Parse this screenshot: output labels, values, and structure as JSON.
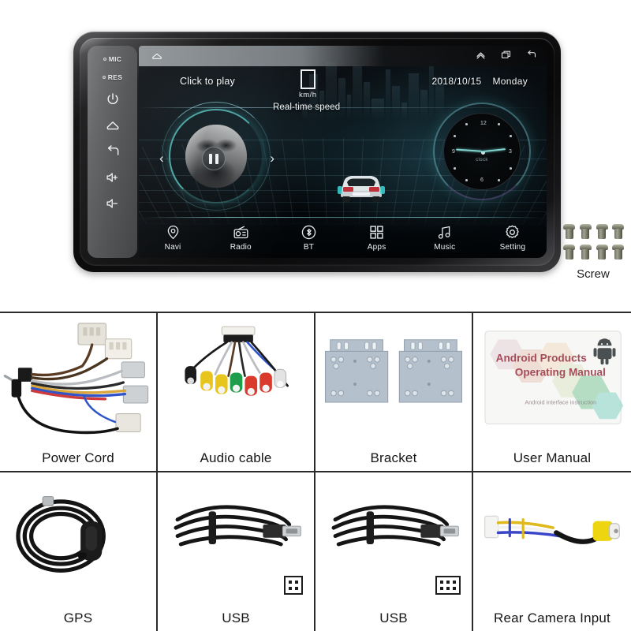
{
  "product": {
    "type": "car-stereo-head-unit-accessory-layout",
    "accent_color": "#5ad2cd",
    "frame_color": "#2b2b2b"
  },
  "head_unit": {
    "side_keys": [
      {
        "name": "mic-indicator",
        "label": "MIC",
        "icon": "led-dot"
      },
      {
        "name": "reset-indicator",
        "label": "RES",
        "icon": "led-dot"
      },
      {
        "name": "power-key",
        "label": "",
        "icon": "power-icon"
      },
      {
        "name": "home-key",
        "label": "",
        "icon": "home-icon"
      },
      {
        "name": "back-key",
        "label": "",
        "icon": "back-arrow-icon"
      },
      {
        "name": "volume-up-key",
        "label": "",
        "icon": "volume-up-icon"
      },
      {
        "name": "volume-down-key",
        "label": "",
        "icon": "volume-down-icon"
      }
    ],
    "status_bar": {
      "home_icon": "home-icon",
      "right_icons": [
        "chevron-up-icon",
        "recent-apps-icon",
        "back-arrow-icon"
      ]
    },
    "screen": {
      "media_hint": "Click to play",
      "speed_value": "",
      "speed_unit": "km/h",
      "speed_caption": "Real-time speed",
      "date": "2018/10/15",
      "weekday": "Monday",
      "clock_label": "clock",
      "clock_numerals": [
        "12",
        "3",
        "6",
        "9"
      ],
      "prev_icon": "chevron-left-icon",
      "next_icon": "chevron-right-icon",
      "play_state_icon": "pause-icon"
    },
    "nav_items": [
      {
        "label": "Navi",
        "icon": "location-pin-icon"
      },
      {
        "label": "Radio",
        "icon": "radio-icon"
      },
      {
        "label": "BT",
        "icon": "bluetooth-icon"
      },
      {
        "label": "Apps",
        "icon": "apps-grid-icon"
      },
      {
        "label": "Music",
        "icon": "music-note-icon"
      },
      {
        "label": "Setting",
        "icon": "gear-icon"
      }
    ]
  },
  "screws": {
    "label": "Screw",
    "count": 8,
    "rows": 2,
    "columns": 4
  },
  "accessories": [
    {
      "label": "Power Cord",
      "art": "power-cord"
    },
    {
      "label": "Audio cable",
      "art": "audio-cable"
    },
    {
      "label": "Bracket",
      "art": "bracket"
    },
    {
      "label": "User Manual",
      "art": "user-manual"
    },
    {
      "label": "GPS",
      "art": "gps-antenna"
    },
    {
      "label": "USB",
      "art": "usb-cable",
      "pins": 4
    },
    {
      "label": "USB",
      "art": "usb-cable",
      "pins": 6
    },
    {
      "label": "Rear Camera Input",
      "art": "rca-camera-lead"
    }
  ],
  "manual_cover": {
    "title_line1": "Android Products",
    "title_line2": "Operating Manual",
    "subtitle": "Android interface instruction",
    "logo_icon": "android-robot-icon"
  }
}
